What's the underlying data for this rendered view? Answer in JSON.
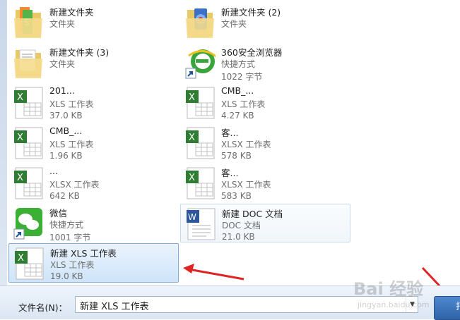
{
  "files": [
    {
      "name": "新建文件夹",
      "type": "文件夹",
      "size": "",
      "icon": "folder-icon"
    },
    {
      "name": "新建文件夹 (2)",
      "type": "文件夹",
      "size": "",
      "icon": "folder-icon"
    },
    {
      "name": "新建文件夹 (3)",
      "type": "文件夹",
      "size": "",
      "icon": "folder-icon"
    },
    {
      "name": "360安全浏览器",
      "type": "快捷方式",
      "size": "1022 字节",
      "icon": "browser-shortcut-icon"
    },
    {
      "name": "201...",
      "type": "XLS 工作表",
      "size": "37.0 KB",
      "icon": "excel-file-icon"
    },
    {
      "name": "CMB_...",
      "type": "XLS 工作表",
      "size": "4.27 KB",
      "icon": "excel-file-icon"
    },
    {
      "name": "CMB_...",
      "type": "XLS 工作表",
      "size": "1.96 KB",
      "icon": "excel-file-icon"
    },
    {
      "name": "客...",
      "type": "XLSX 工作表",
      "size": "578 KB",
      "icon": "excel-file-icon"
    },
    {
      "name": "...",
      "type": "XLSX 工作表",
      "size": "642 KB",
      "icon": "excel-file-icon"
    },
    {
      "name": "客...",
      "type": "XLSX 工作表",
      "size": "583 KB",
      "icon": "excel-file-icon"
    },
    {
      "name": "微信",
      "type": "快捷方式",
      "size": "1001 字节",
      "icon": "wechat-shortcut-icon"
    },
    {
      "name": "新建 DOC 文档",
      "type": "DOC 文档",
      "size": "21.0 KB",
      "icon": "word-file-icon"
    },
    {
      "name": "新建 XLS 工作表",
      "type": "XLS 工作表",
      "size": "19.0 KB",
      "icon": "excel-file-icon"
    }
  ],
  "filename": {
    "label": "文件名(N)：",
    "value": "新建 XLS 工作表"
  },
  "open_button": {
    "label": "打"
  },
  "watermark": {
    "brand": "Bai 经验",
    "url": "jingyan.baidu.com"
  },
  "colors": {
    "selection": "#cfe4fa",
    "accent_arrow": "#e02424",
    "excel_green": "#2e7d32",
    "word_blue": "#2b579a"
  }
}
